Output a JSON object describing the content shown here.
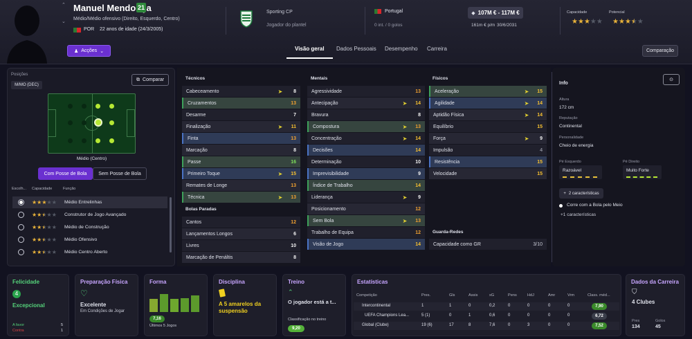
{
  "player": {
    "name": "Manuel Mendonça",
    "age_badge": "21",
    "positions_line": "Médio/Médio ofensivo (Direito, Esquerdo, Centro)",
    "nationality": "POR",
    "age_text": "22 anos de idade (24/3/2005)"
  },
  "actions_label": "Acções",
  "club": {
    "name": "Sporting CP",
    "role": "Jogador do plantel"
  },
  "country": {
    "name": "Portugal",
    "intl": "0 int. / 0 golos"
  },
  "value": {
    "range": "107M € - 117M €",
    "wage": "161m € p/m",
    "contract": "30/6/2031"
  },
  "ratings": {
    "capacity_label": "Capacidade",
    "capacity_stars": 3,
    "potential_label": "Potencial",
    "potential_stars": 3.5
  },
  "tabs": [
    "Visão geral",
    "Dados Pessoais",
    "Desempenho",
    "Carreira"
  ],
  "compare_button": "Comparação",
  "left": {
    "positions_label": "Posições",
    "position": "M/MO (DEC)",
    "compare_button": "Comparar",
    "role_name": "Médio (Centro)",
    "tab_with": "Com Posse de Bola",
    "tab_without": "Sem Posse de Bola",
    "headers": [
      "Escolh...",
      "Capacidade",
      "Função"
    ],
    "roles": [
      {
        "stars": 3,
        "name": "Médio Entrelinhas",
        "selected": true
      },
      {
        "stars": 2.5,
        "name": "Construtor de Jogo Avançado",
        "selected": false
      },
      {
        "stars": 2.5,
        "name": "Médio de Construção",
        "selected": false
      },
      {
        "stars": 2.5,
        "name": "Médio Ofensivo",
        "selected": false
      },
      {
        "stars": 2.5,
        "name": "Médio Centro Aberto",
        "selected": false
      }
    ]
  },
  "attributes": {
    "technical_title": "Técnicos",
    "technical": [
      {
        "name": "Cabeceamento",
        "value": "8",
        "arrow": true,
        "style": "dark",
        "col": "w"
      },
      {
        "name": "Cruzamentos",
        "value": "13",
        "arrow": false,
        "style": "hi",
        "col": "o"
      },
      {
        "name": "Desarme",
        "value": "7",
        "arrow": false,
        "style": "dark",
        "col": "w"
      },
      {
        "name": "Finalização",
        "value": "11",
        "arrow": true,
        "style": "light",
        "col": "y"
      },
      {
        "name": "Finta",
        "value": "13",
        "arrow": false,
        "style": "blue",
        "col": "o"
      },
      {
        "name": "Marcação",
        "value": "8",
        "arrow": false,
        "style": "light",
        "col": "w"
      },
      {
        "name": "Passe",
        "value": "16",
        "arrow": false,
        "style": "hi",
        "col": "g"
      },
      {
        "name": "Primeiro Toque",
        "value": "15",
        "arrow": true,
        "style": "blue",
        "col": "y"
      },
      {
        "name": "Remates de Longe",
        "value": "13",
        "arrow": false,
        "style": "light",
        "col": "o"
      },
      {
        "name": "Técnica",
        "value": "13",
        "arrow": true,
        "style": "hi",
        "col": "o"
      }
    ],
    "set_pieces_title": "Bolas Paradas",
    "set_pieces": [
      {
        "name": "Cantos",
        "value": "12",
        "arrow": false,
        "style": "dark",
        "col": "o"
      },
      {
        "name": "Lançamentos Longos",
        "value": "6",
        "arrow": false,
        "style": "light",
        "col": "w"
      },
      {
        "name": "Livres",
        "value": "10",
        "arrow": false,
        "style": "dark",
        "col": "w"
      },
      {
        "name": "Marcação de Penáltis",
        "value": "8",
        "arrow": false,
        "style": "light",
        "col": "w"
      }
    ],
    "mental_title": "Mentais",
    "mental": [
      {
        "name": "Agressividade",
        "value": "13",
        "arrow": false,
        "style": "dark",
        "col": "o"
      },
      {
        "name": "Antecipação",
        "value": "14",
        "arrow": true,
        "style": "light",
        "col": "y"
      },
      {
        "name": "Bravura",
        "value": "8",
        "arrow": false,
        "style": "dark",
        "col": "w"
      },
      {
        "name": "Compostura",
        "value": "13",
        "arrow": true,
        "style": "hi",
        "col": "o"
      },
      {
        "name": "Concentração",
        "value": "14",
        "arrow": true,
        "style": "dark",
        "col": "y"
      },
      {
        "name": "Decisões",
        "value": "14",
        "arrow": false,
        "style": "blue",
        "col": "y"
      },
      {
        "name": "Determinação",
        "value": "10",
        "arrow": false,
        "style": "dark",
        "col": "w"
      },
      {
        "name": "Imprevisibilidade",
        "value": "9",
        "arrow": false,
        "style": "blue",
        "col": "w"
      },
      {
        "name": "Índice de Trabalho",
        "value": "14",
        "arrow": false,
        "style": "hi",
        "col": "y"
      },
      {
        "name": "Liderança",
        "value": "9",
        "arrow": true,
        "style": "dark",
        "col": "w"
      },
      {
        "name": "Posicionamento",
        "value": "12",
        "arrow": false,
        "style": "light",
        "col": "o"
      },
      {
        "name": "Sem Bola",
        "value": "13",
        "arrow": true,
        "style": "hi",
        "col": "o"
      },
      {
        "name": "Trabalho de Equipa",
        "value": "12",
        "arrow": false,
        "style": "dark",
        "col": "o"
      },
      {
        "name": "Visão de Jogo",
        "value": "14",
        "arrow": false,
        "style": "blue",
        "col": "y"
      }
    ],
    "physical_title": "Físicos",
    "physical": [
      {
        "name": "Aceleração",
        "value": "15",
        "arrow": true,
        "style": "hi",
        "col": "y"
      },
      {
        "name": "Agilidade",
        "value": "14",
        "arrow": true,
        "style": "blue",
        "col": "y"
      },
      {
        "name": "Aptidão Física",
        "value": "14",
        "arrow": true,
        "style": "light",
        "col": "y"
      },
      {
        "name": "Equilíbrio",
        "value": "15",
        "arrow": false,
        "style": "dark",
        "col": "y"
      },
      {
        "name": "Força",
        "value": "9",
        "arrow": true,
        "style": "light",
        "col": "w"
      },
      {
        "name": "Impulsão",
        "value": "4",
        "arrow": false,
        "style": "dark",
        "col": "d"
      },
      {
        "name": "Resistência",
        "value": "15",
        "arrow": false,
        "style": "blue",
        "col": "y"
      },
      {
        "name": "Velocidade",
        "value": "15",
        "arrow": false,
        "style": "light",
        "col": "y"
      }
    ],
    "gk_title": "Guarda-Redes",
    "gk_row": {
      "name": "Capacidade como GR",
      "value": "3/10"
    }
  },
  "info": {
    "title": "Info",
    "height_label": "Altura",
    "height": "172 cm",
    "rep_label": "Reputação",
    "rep": "Continental",
    "pers_label": "Personalidade",
    "pers": "Cheio de energia",
    "lfoot_label": "Pé Esquerdo",
    "lfoot": "Razoável",
    "rfoot_label": "Pé Direito",
    "rfoot": "Muito Forte",
    "traits_button": "2 características",
    "trait1": "Corre com a Bola pelo Meio",
    "more_traits": "+1 características"
  },
  "cards": {
    "happiness": {
      "title": "Felicidade",
      "value": "Excepcional",
      "l1": "A favor",
      "v1": "5",
      "l2": "Contra",
      "v2": "1"
    },
    "fitness": {
      "title": "Preparação Física",
      "value": "Excelente",
      "sub": "Em Condições de Jogar"
    },
    "form": {
      "title": "Forma",
      "rating": "7,16",
      "sub": "Últimos 5 Jogos",
      "bars": [
        0.55,
        0.75,
        0.55,
        0.6,
        0.7
      ]
    },
    "discipline": {
      "title": "Disciplina",
      "value": "A 5 amarelos da suspensão"
    },
    "training": {
      "title": "Treino",
      "value": "O jogador está a t...",
      "sub": "Classificação no treino",
      "rating": "9,20"
    },
    "stats": {
      "title": "Estatísticas",
      "headers": [
        "Competição",
        "Pres.",
        "Gls",
        "Assis",
        "xG",
        "Pens",
        "HdJ",
        "Amr",
        "Vrm",
        "Class. méd..."
      ],
      "rows": [
        [
          "Intercontinental",
          "1",
          "1",
          "0",
          "0,2",
          "0",
          "0",
          "0",
          "0",
          "7,90"
        ],
        [
          "UEFA Champions Lea...",
          "5 (1)",
          "0",
          "1",
          "0,6",
          "0",
          "0",
          "0",
          "0",
          "6,72"
        ],
        [
          "Global (Clube)",
          "19 (6)",
          "17",
          "8",
          "7,6",
          "0",
          "3",
          "0",
          "0",
          "7,52"
        ]
      ]
    },
    "career": {
      "title": "Dados da Carreira",
      "value": "4 Clubes",
      "l1": "Pres",
      "v1": "134",
      "l2": "Golos",
      "v2": "45"
    }
  },
  "colors": {
    "accent": "#7a3de0",
    "stars": "#e8b23a",
    "green": "#3da15a",
    "yellow": "#f6c030"
  }
}
